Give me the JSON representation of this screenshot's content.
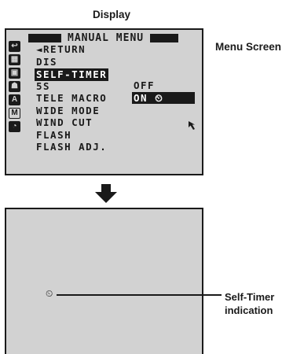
{
  "display_heading": "Display",
  "menu_screen_caption": "Menu Screen",
  "menu": {
    "title": "MANUAL MENU",
    "items": [
      "◄RETURN",
      "DIS",
      "SELF-TIMER",
      "5S",
      "TELE MACRO",
      "WIDE MODE",
      "WIND CUT",
      "FLASH",
      "FLASH ADJ."
    ],
    "selected_item": "SELF-TIMER",
    "options": [
      "OFF",
      "ON ⏲"
    ],
    "selected_option": "ON ⏲"
  },
  "sidebar_icons": [
    "return-icon",
    "dis-icon",
    "cam-icon",
    "person-icon",
    "am-icon",
    "m-icon",
    "clock-icon"
  ],
  "self_timer_symbol": "⏲",
  "indication_caption_line1": "Self-Timer",
  "indication_caption_line2": "indication",
  "colors": {
    "screen_bg": "#d2d2d2",
    "ink": "#1a1a1a"
  }
}
